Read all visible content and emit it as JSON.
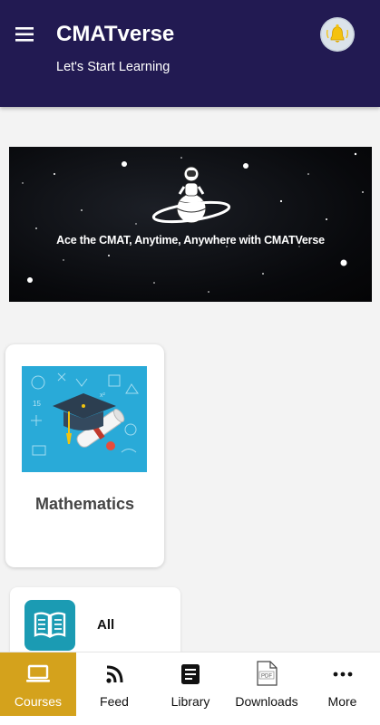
{
  "header": {
    "title": "CMATverse",
    "subtitle": "Let's Start Learning",
    "menu_icon": "hamburger-menu-icon",
    "bell_icon": "bell-icon",
    "background_color": "#221a52"
  },
  "banner": {
    "text": "Ace the CMAT, Anytime, Anywhere with CMATVerse",
    "image": "astronaut-on-planet"
  },
  "courses": [
    {
      "name": "Mathematics",
      "thumbnail": "graduation-cap-and-diploma"
    }
  ],
  "categories": [
    {
      "label": "All",
      "icon": "open-book-icon",
      "icon_color": "#1b9bb3"
    }
  ],
  "bottom_nav": {
    "active_color": "#d4a21c",
    "items": [
      {
        "label": "Courses",
        "icon": "laptop-icon",
        "active": true
      },
      {
        "label": "Feed",
        "icon": "rss-feed-icon",
        "active": false
      },
      {
        "label": "Library",
        "icon": "library-book-icon",
        "active": false
      },
      {
        "label": "Downloads",
        "icon": "pdf-file-icon",
        "active": false
      },
      {
        "label": "More",
        "icon": "more-dots-icon",
        "active": false
      }
    ]
  }
}
